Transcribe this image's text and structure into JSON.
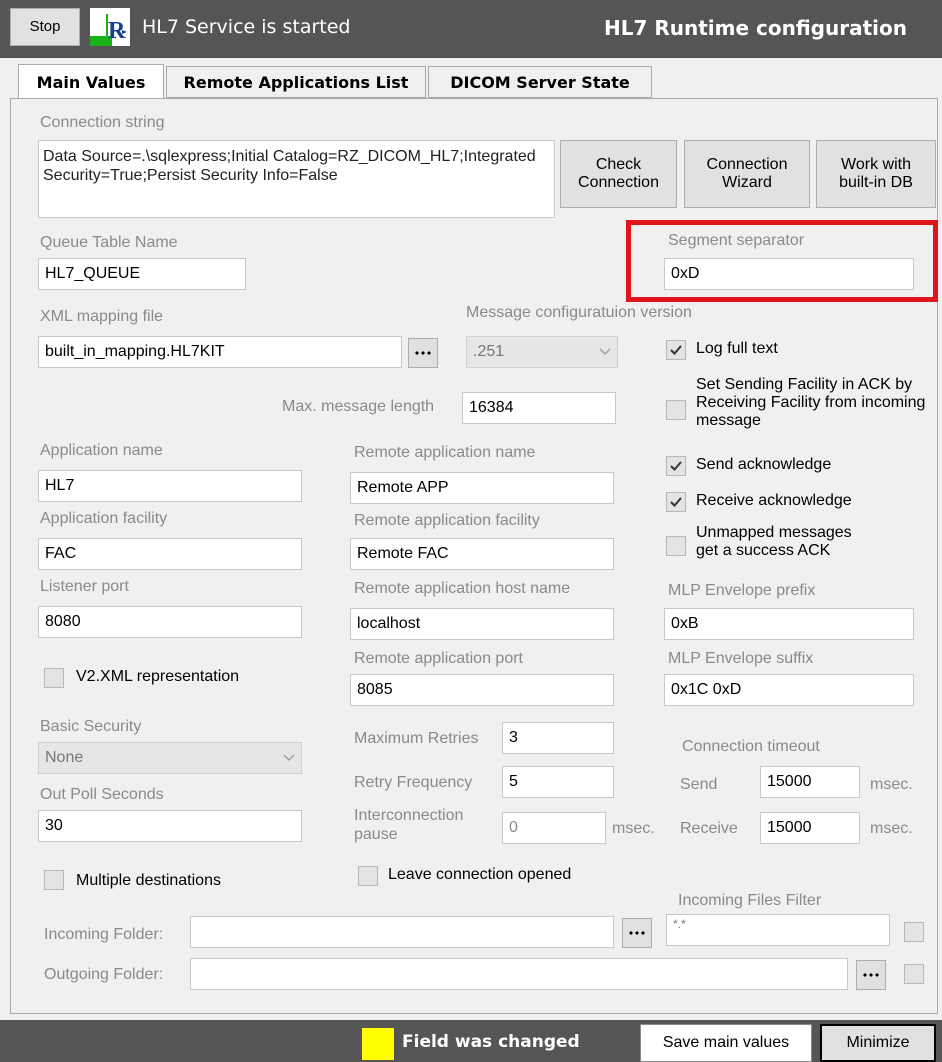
{
  "header": {
    "stop_label": "Stop",
    "service_status": "HL7 Service is started",
    "title": "HL7 Runtime configuration"
  },
  "tabs": [
    "Main Values",
    "Remote Applications List",
    "DICOM Server State"
  ],
  "connection": {
    "label": "Connection string",
    "value": "Data Source=.\\sqlexpress;Initial Catalog=RZ_DICOM_HL7;Integrated Security=True;Persist Security Info=False",
    "check_button": "Check Connection",
    "wizard_button": "Connection Wizard",
    "builtin_button": "Work with built-in DB"
  },
  "queue": {
    "label": "Queue Table Name",
    "value": "HL7_QUEUE"
  },
  "segment_separator": {
    "label": "Segment separator",
    "value": "0xD",
    "highlight_color": "#e0141c"
  },
  "xml_mapping": {
    "label": "XML mapping file",
    "value": "built_in_mapping.HL7KIT"
  },
  "msg_config": {
    "label": "Message configuratuion version",
    "value": ".251"
  },
  "max_length": {
    "label": "Max. message length",
    "value": "16384"
  },
  "checkboxes": {
    "log_full_text": {
      "label": "Log full text",
      "checked": true
    },
    "set_sending_facility": {
      "label": "Set Sending Facility in ACK by Receiving Facility from incoming message",
      "checked": false
    },
    "send_ack": {
      "label": "Send acknowledge",
      "checked": true
    },
    "receive_ack": {
      "label": "Receive acknowledge",
      "checked": true
    },
    "unmapped": {
      "label": "Unmapped messages get a success ACK",
      "checked": false
    },
    "v2xml": {
      "label": "V2.XML representation",
      "checked": false
    },
    "multiple_destinations": {
      "label": "Multiple destinations",
      "checked": false
    },
    "leave_connection": {
      "label": "Leave connection opened",
      "checked": false
    }
  },
  "app": {
    "name_label": "Application name",
    "name_value": "HL7",
    "facility_label": "Application facility",
    "facility_value": "FAC",
    "port_label": "Listener port",
    "port_value": "8080"
  },
  "remote": {
    "name_label": "Remote application name",
    "name_value": "Remote APP",
    "facility_label": "Remote application facility",
    "facility_value": "Remote FAC",
    "host_label": "Remote application host name",
    "host_value": "localhost",
    "port_label": "Remote application port",
    "port_value": "8085"
  },
  "mlp": {
    "prefix_label": "MLP Envelope prefix",
    "prefix_value": "0xB",
    "suffix_label": "MLP Envelope suffix",
    "suffix_value": "0x1C 0xD"
  },
  "security": {
    "label": "Basic Security",
    "value": "None"
  },
  "poll": {
    "label": "Out Poll Seconds",
    "value": "30"
  },
  "retries": {
    "max_label": "Maximum Retries",
    "max_value": "3",
    "freq_label": "Retry Frequency",
    "freq_value": "5",
    "pause_label": "Interconnection pause",
    "pause_value": "0",
    "pause_unit": "msec."
  },
  "timeout": {
    "label": "Connection timeout",
    "send_label": "Send",
    "send_value": "15000",
    "send_unit": "msec.",
    "receive_label": "Receive",
    "receive_value": "15000",
    "receive_unit": "msec."
  },
  "folders": {
    "filter_label": "Incoming Files Filter",
    "filter_value": "*.*",
    "incoming_label": "Incoming Folder:",
    "incoming_value": "",
    "outgoing_label": "Outgoing Folder:",
    "outgoing_value": ""
  },
  "footer": {
    "changed_label": "Field was changed",
    "changed_color": "#ffff00",
    "save_button": "Save main values",
    "minimize_button": "Minimize"
  }
}
